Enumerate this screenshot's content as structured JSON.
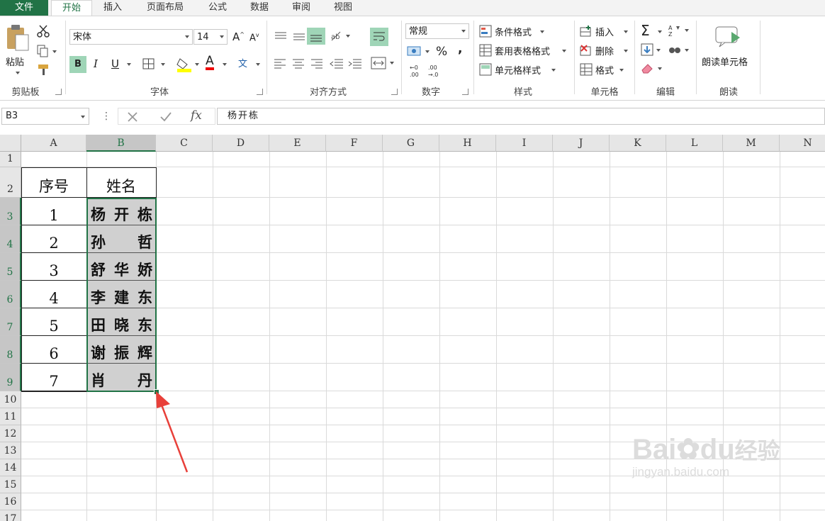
{
  "ribbon": {
    "tabs": [
      "文件",
      "开始",
      "插入",
      "页面布局",
      "公式",
      "数据",
      "审阅",
      "视图"
    ],
    "clipboard": {
      "paste": "粘贴",
      "group": "剪贴板"
    },
    "font": {
      "name": "宋体",
      "size": "14",
      "bold": "B",
      "italic": "I",
      "underline": "U",
      "font_color_letter": "A",
      "phonetic": "文",
      "group": "字体"
    },
    "alignment": {
      "group": "对齐方式"
    },
    "number": {
      "format": "常规",
      "percent": "%",
      "comma": ",",
      "group": "数字"
    },
    "styles": {
      "conditional": "条件格式",
      "table": "套用表格格式",
      "cell_styles": "单元格样式",
      "group": "样式"
    },
    "cells": {
      "insert": "插入",
      "delete": "删除",
      "format": "格式",
      "group": "单元格"
    },
    "editing": {
      "sum": "Σ",
      "group": "编辑"
    },
    "read": {
      "label": "朗读单元格",
      "group": "朗读"
    }
  },
  "formula_bar": {
    "name_box": "B3",
    "fx": "fx",
    "content": "杨开栋"
  },
  "sheet": {
    "columns": [
      "A",
      "B",
      "C",
      "D",
      "E",
      "F",
      "G",
      "H",
      "I",
      "J",
      "K",
      "L",
      "M",
      "N"
    ],
    "rows": [
      "1",
      "2",
      "3",
      "4",
      "5",
      "6",
      "7",
      "8",
      "9",
      "10",
      "11",
      "12",
      "13",
      "14",
      "15",
      "16",
      "17"
    ],
    "header": {
      "a": "序号",
      "b": "姓名"
    },
    "records": [
      {
        "no": "1",
        "name": [
          "杨",
          "开",
          "栋"
        ]
      },
      {
        "no": "2",
        "name": [
          "孙",
          "哲"
        ]
      },
      {
        "no": "3",
        "name": [
          "舒",
          "华",
          "娇"
        ]
      },
      {
        "no": "4",
        "name": [
          "李",
          "建",
          "东"
        ]
      },
      {
        "no": "5",
        "name": [
          "田",
          "晓",
          "东"
        ]
      },
      {
        "no": "6",
        "name": [
          "谢",
          "振",
          "辉"
        ]
      },
      {
        "no": "7",
        "name": [
          "肖",
          "丹"
        ]
      }
    ],
    "selected_column": "B",
    "selected_rows": [
      "3",
      "4",
      "5",
      "6",
      "7",
      "8",
      "9"
    ]
  },
  "colors": {
    "accent": "#217346",
    "arrow": "#e8403a",
    "selection": "#a6a6a6"
  },
  "watermark": {
    "brand": "Bai",
    "brand2": "du",
    "cn": "经验",
    "url": "jingyan.baidu.com"
  }
}
